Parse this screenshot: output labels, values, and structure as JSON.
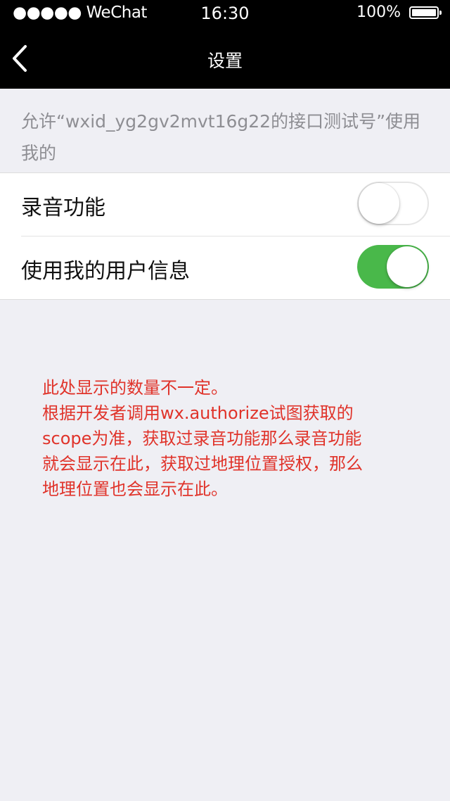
{
  "status_bar": {
    "carrier": "●●●●● WeChat",
    "time": "16:30",
    "battery": "100%"
  },
  "nav": {
    "title": "设置",
    "back_icon": "chevron-left-icon"
  },
  "permission_description": "允许“wxid_yg2gv2mvt16g22的接口测试号”使用我的",
  "settings": [
    {
      "label": "录音功能",
      "enabled": false
    },
    {
      "label": "使用我的用户信息",
      "enabled": true
    }
  ],
  "annotation": {
    "lines": [
      "此处显示的数量不一定。",
      "根据开发者调用wx.authorize试图获取的",
      "scope为准，获取过录音功能那么录音功能",
      "就会显示在此，获取过地理位置授权，那么",
      "地理位置也会显示在此。"
    ]
  },
  "colors": {
    "toggle_on": "#49b84a",
    "annotation_text": "#e0332a",
    "background": "#efeff4"
  }
}
